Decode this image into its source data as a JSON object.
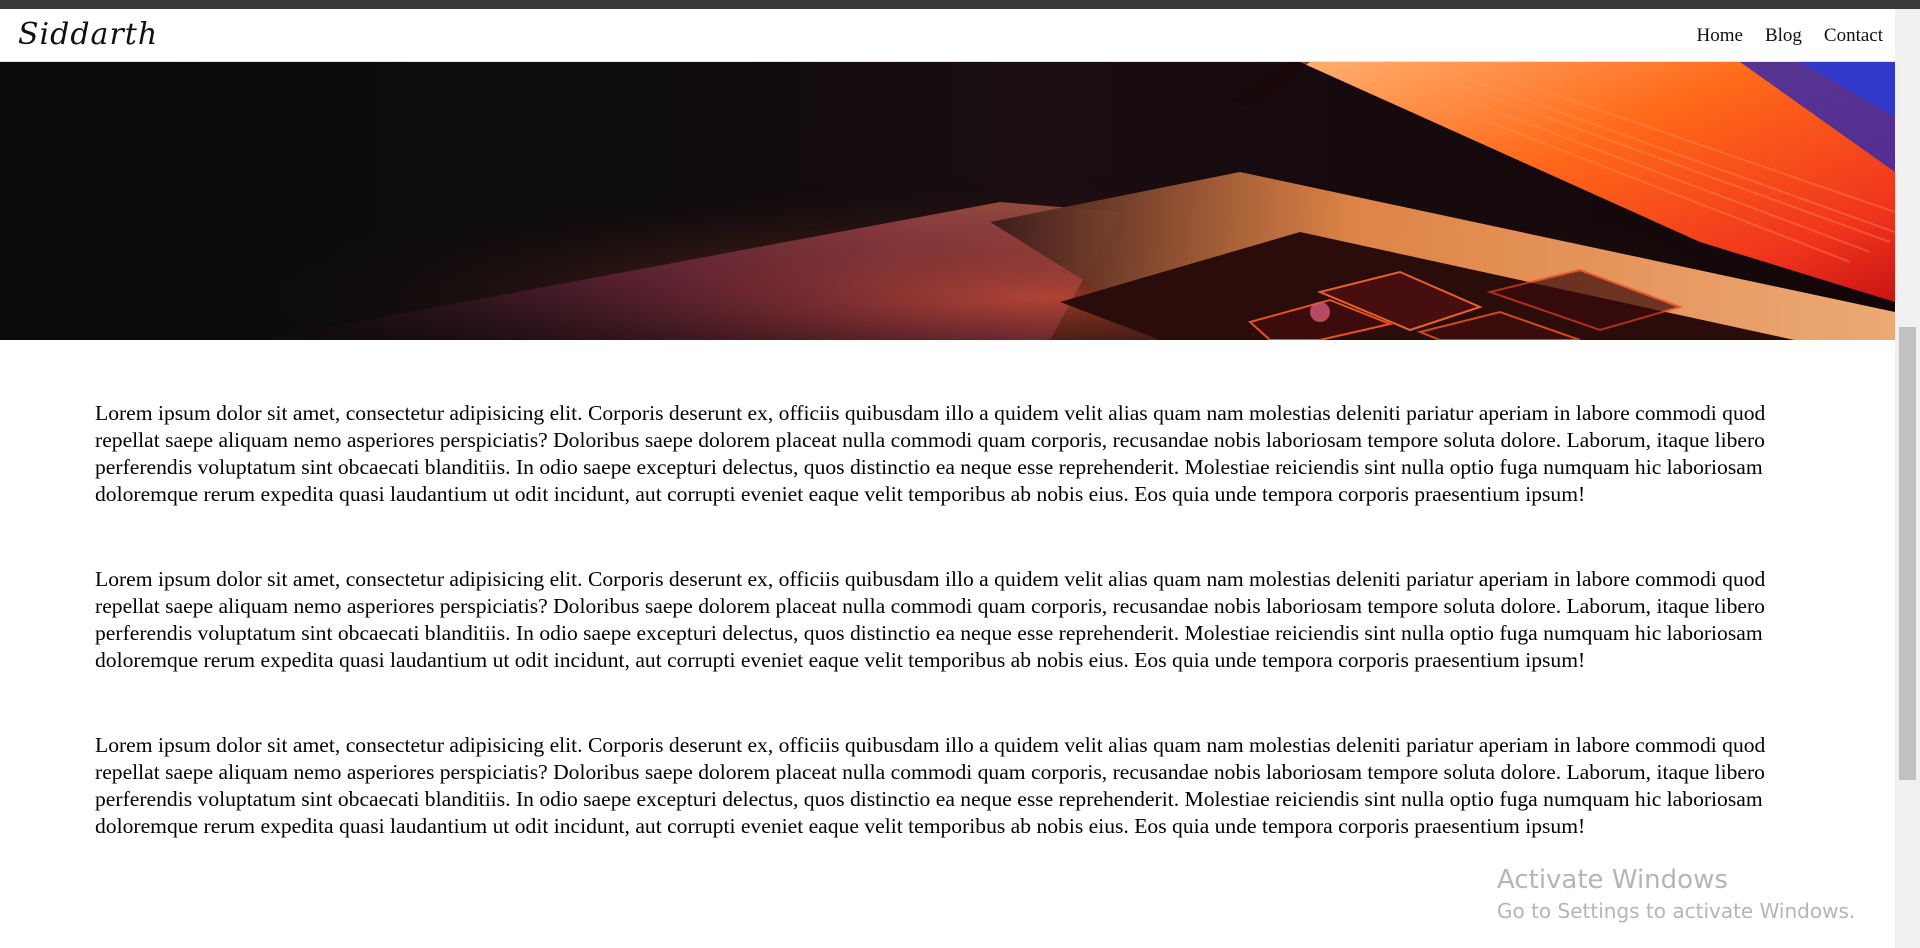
{
  "navbar": {
    "brand": "Siddarth",
    "links": [
      {
        "label": "Home"
      },
      {
        "label": "Blog"
      },
      {
        "label": "Contact"
      }
    ]
  },
  "hero": {
    "image_description_icon": "laptop-keyboard-image"
  },
  "content": {
    "paragraphs": [
      "Lorem ipsum dolor sit amet, consectetur adipisicing elit. Corporis deserunt ex, officiis quibusdam illo a quidem velit alias quam nam molestias deleniti pariatur aperiam in labore commodi quod repellat saepe aliquam nemo asperiores perspiciatis? Doloribus saepe dolorem placeat nulla commodi quam corporis, recusandae nobis laboriosam tempore soluta dolore. Laborum, itaque libero perferendis voluptatum sint obcaecati blanditiis. In odio saepe excepturi delectus, quos distinctio ea neque esse reprehenderit. Molestiae reiciendis sint nulla optio fuga numquam hic laboriosam doloremque rerum expedita quasi laudantium ut odit incidunt, aut corrupti eveniet eaque velit temporibus ab nobis eius. Eos quia unde tempora corporis praesentium ipsum!",
      "Lorem ipsum dolor sit amet, consectetur adipisicing elit. Corporis deserunt ex, officiis quibusdam illo a quidem velit alias quam nam molestias deleniti pariatur aperiam in labore commodi quod repellat saepe aliquam nemo asperiores perspiciatis? Doloribus saepe dolorem placeat nulla commodi quam corporis, recusandae nobis laboriosam tempore soluta dolore. Laborum, itaque libero perferendis voluptatum sint obcaecati blanditiis. In odio saepe excepturi delectus, quos distinctio ea neque esse reprehenderit. Molestiae reiciendis sint nulla optio fuga numquam hic laboriosam doloremque rerum expedita quasi laudantium ut odit incidunt, aut corrupti eveniet eaque velit temporibus ab nobis eius. Eos quia unde tempora corporis praesentium ipsum!",
      "Lorem ipsum dolor sit amet, consectetur adipisicing elit. Corporis deserunt ex, officiis quibusdam illo a quidem velit alias quam nam molestias deleniti pariatur aperiam in labore commodi quod repellat saepe aliquam nemo asperiores perspiciatis? Doloribus saepe dolorem placeat nulla commodi quam corporis, recusandae nobis laboriosam tempore soluta dolore. Laborum, itaque libero perferendis voluptatum sint obcaecati blanditiis. In odio saepe excepturi delectus, quos distinctio ea neque esse reprehenderit. Molestiae reiciendis sint nulla optio fuga numquam hic laboriosam doloremque rerum expedita quasi laudantium ut odit incidunt, aut corrupti eveniet eaque velit temporibus ab nobis eius. Eos quia unde tempora corporis praesentium ipsum!"
    ]
  },
  "watermark": {
    "line1": "Activate Windows",
    "line2": "Go to Settings to activate Windows."
  },
  "colors": {
    "navbar_bg": "#ffffff",
    "hero_dark": "#0d0d0e",
    "hero_orange": "#ff6a1a",
    "hero_red": "#e8261c",
    "text": "#000000"
  }
}
